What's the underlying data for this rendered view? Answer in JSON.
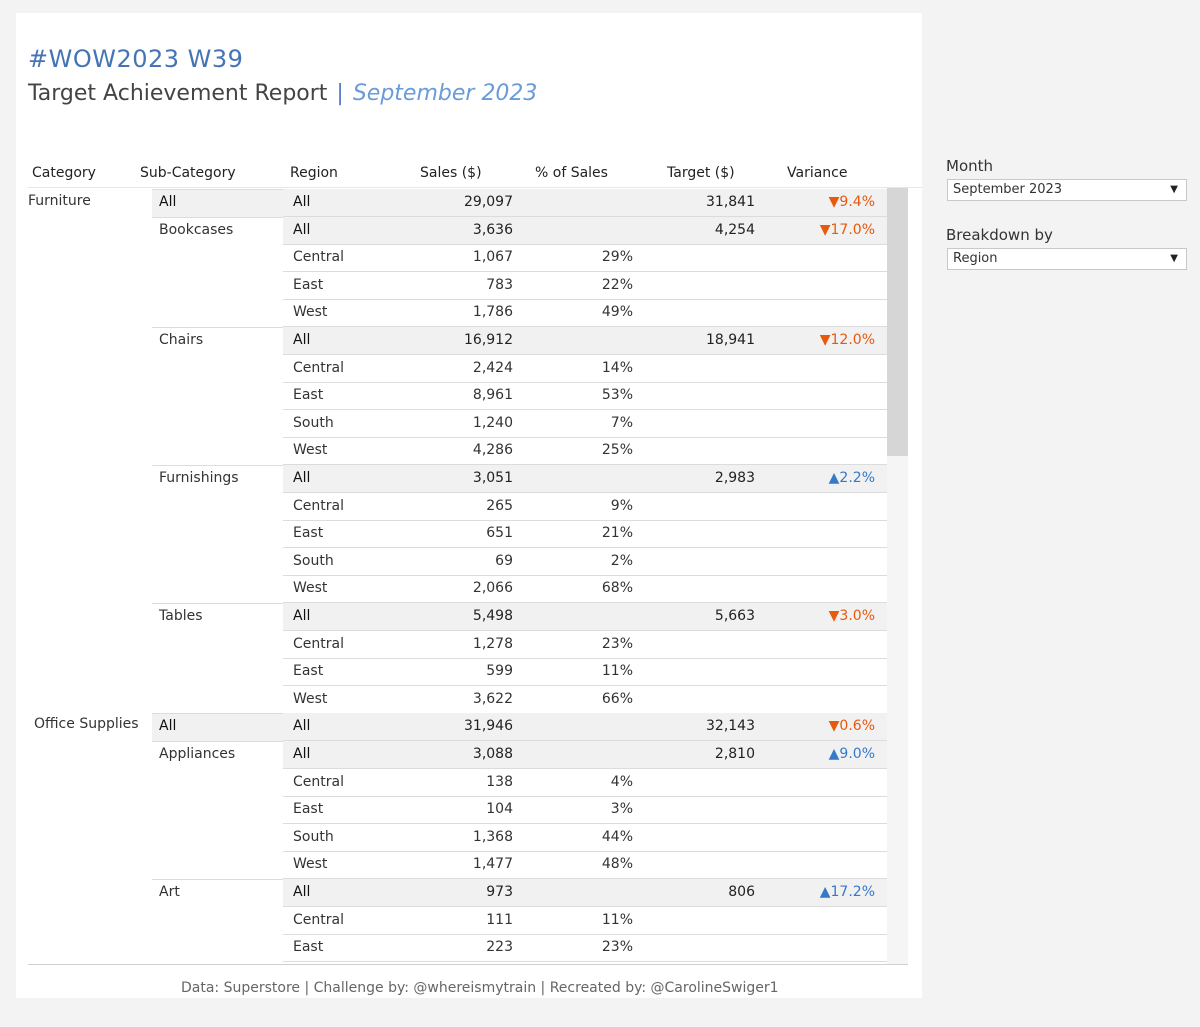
{
  "header": {
    "title": "#WOW2023 W39",
    "subtitle": "Target Achievement Report",
    "separator": "|",
    "month": "September 2023"
  },
  "columns": {
    "category": "Category",
    "sub_category": "Sub-Category",
    "region": "Region",
    "sales": "Sales ($)",
    "pct_sales": "% of Sales",
    "target": "Target ($)",
    "variance": "Variance"
  },
  "categories": [
    {
      "name": "Furniture"
    },
    {
      "name": "Office Supplies"
    }
  ],
  "subcategories": [
    {
      "name": "All"
    },
    {
      "name": "Bookcases"
    },
    {
      "name": "Chairs"
    },
    {
      "name": "Furnishings"
    },
    {
      "name": "Tables"
    },
    {
      "name": "All"
    },
    {
      "name": "Appliances"
    },
    {
      "name": "Art"
    }
  ],
  "rows": [
    {
      "region": "All",
      "sales": "29,097",
      "pct": "",
      "target": "31,841",
      "variance": "▼9.4%",
      "dir": "down"
    },
    {
      "region": "All",
      "sales": "3,636",
      "pct": "",
      "target": "4,254",
      "variance": "▼17.0%",
      "dir": "down"
    },
    {
      "region": "Central",
      "sales": "1,067",
      "pct": "29%",
      "target": "",
      "variance": "",
      "dir": ""
    },
    {
      "region": "East",
      "sales": "783",
      "pct": "22%",
      "target": "",
      "variance": "",
      "dir": ""
    },
    {
      "region": "West",
      "sales": "1,786",
      "pct": "49%",
      "target": "",
      "variance": "",
      "dir": ""
    },
    {
      "region": "All",
      "sales": "16,912",
      "pct": "",
      "target": "18,941",
      "variance": "▼12.0%",
      "dir": "down"
    },
    {
      "region": "Central",
      "sales": "2,424",
      "pct": "14%",
      "target": "",
      "variance": "",
      "dir": ""
    },
    {
      "region": "East",
      "sales": "8,961",
      "pct": "53%",
      "target": "",
      "variance": "",
      "dir": ""
    },
    {
      "region": "South",
      "sales": "1,240",
      "pct": "7%",
      "target": "",
      "variance": "",
      "dir": ""
    },
    {
      "region": "West",
      "sales": "4,286",
      "pct": "25%",
      "target": "",
      "variance": "",
      "dir": ""
    },
    {
      "region": "All",
      "sales": "3,051",
      "pct": "",
      "target": "2,983",
      "variance": "▲2.2%",
      "dir": "up"
    },
    {
      "region": "Central",
      "sales": "265",
      "pct": "9%",
      "target": "",
      "variance": "",
      "dir": ""
    },
    {
      "region": "East",
      "sales": "651",
      "pct": "21%",
      "target": "",
      "variance": "",
      "dir": ""
    },
    {
      "region": "South",
      "sales": "69",
      "pct": "2%",
      "target": "",
      "variance": "",
      "dir": ""
    },
    {
      "region": "West",
      "sales": "2,066",
      "pct": "68%",
      "target": "",
      "variance": "",
      "dir": ""
    },
    {
      "region": "All",
      "sales": "5,498",
      "pct": "",
      "target": "5,663",
      "variance": "▼3.0%",
      "dir": "down"
    },
    {
      "region": "Central",
      "sales": "1,278",
      "pct": "23%",
      "target": "",
      "variance": "",
      "dir": ""
    },
    {
      "region": "East",
      "sales": "599",
      "pct": "11%",
      "target": "",
      "variance": "",
      "dir": ""
    },
    {
      "region": "West",
      "sales": "3,622",
      "pct": "66%",
      "target": "",
      "variance": "",
      "dir": ""
    },
    {
      "region": "All",
      "sales": "31,946",
      "pct": "",
      "target": "32,143",
      "variance": "▼0.6%",
      "dir": "down"
    },
    {
      "region": "All",
      "sales": "3,088",
      "pct": "",
      "target": "2,810",
      "variance": "▲9.0%",
      "dir": "up"
    },
    {
      "region": "Central",
      "sales": "138",
      "pct": "4%",
      "target": "",
      "variance": "",
      "dir": ""
    },
    {
      "region": "East",
      "sales": "104",
      "pct": "3%",
      "target": "",
      "variance": "",
      "dir": ""
    },
    {
      "region": "South",
      "sales": "1,368",
      "pct": "44%",
      "target": "",
      "variance": "",
      "dir": ""
    },
    {
      "region": "West",
      "sales": "1,477",
      "pct": "48%",
      "target": "",
      "variance": "",
      "dir": ""
    },
    {
      "region": "All",
      "sales": "973",
      "pct": "",
      "target": "806",
      "variance": "▲17.2%",
      "dir": "up"
    },
    {
      "region": "Central",
      "sales": "111",
      "pct": "11%",
      "target": "",
      "variance": "",
      "dir": ""
    },
    {
      "region": "East",
      "sales": "223",
      "pct": "23%",
      "target": "",
      "variance": "",
      "dir": ""
    }
  ],
  "footer": "Data: Superstore | Challenge by: @whereismytrain | Recreated by: @CarolineSwiger1",
  "controls": {
    "month_label": "Month",
    "month_value": "September 2023",
    "breakdown_label": "Breakdown by",
    "breakdown_value": "Region",
    "caret": "▼"
  },
  "colors": {
    "title": "#4574b5",
    "decrease": "#e8590c",
    "increase": "#3579c9"
  }
}
